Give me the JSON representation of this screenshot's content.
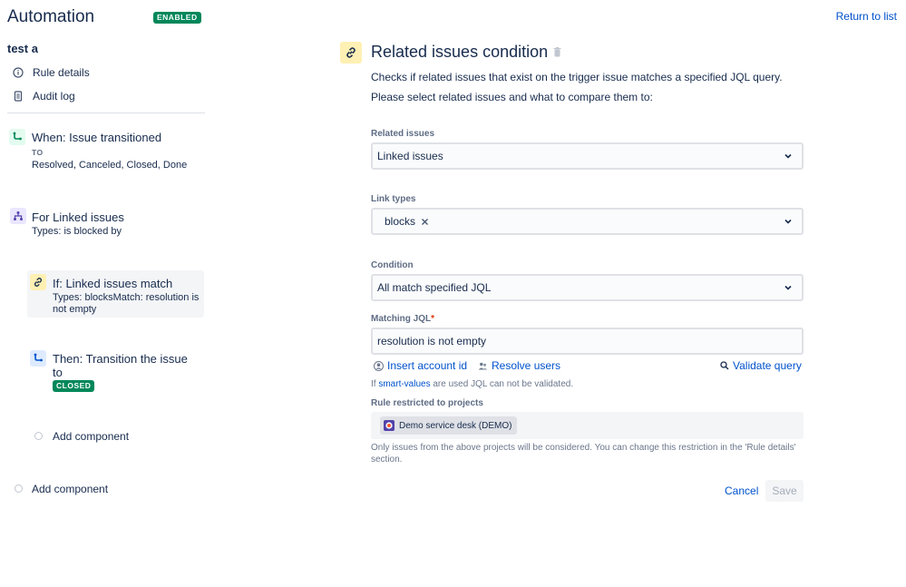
{
  "header": {
    "app_title": "Automation",
    "status_badge": "ENABLED",
    "return_link": "Return to list"
  },
  "sidebar": {
    "rule_name": "test a",
    "nav": [
      {
        "label": "Rule details",
        "icon": "info-icon"
      },
      {
        "label": "Audit log",
        "icon": "document-icon"
      }
    ],
    "trigger": {
      "title": "When: Issue transitioned",
      "to_label": "TO",
      "statuses": "Resolved, Canceled, Closed, Done"
    },
    "branch": {
      "title": "For Linked issues",
      "subtitle": "Types: is blocked by"
    },
    "condition": {
      "title": "If: Linked issues match",
      "subtitle": "Types: blocksMatch: resolution is not empty"
    },
    "action": {
      "title": "Then: Transition the issue to",
      "badge": "CLOSED"
    },
    "add_component_inner": "Add component",
    "add_component_outer": "Add component"
  },
  "panel": {
    "title": "Related issues condition",
    "description_1": "Checks if related issues that exist on the trigger issue matches a specified JQL query.",
    "description_2": "Please select related issues and what to compare them to:",
    "related_issues": {
      "label": "Related issues",
      "value": "Linked issues"
    },
    "link_types": {
      "label": "Link types",
      "tags": [
        "blocks"
      ]
    },
    "condition": {
      "label": "Condition",
      "value": "All match specified JQL"
    },
    "matching_jql": {
      "label": "Matching JQL",
      "required_mark": "*",
      "value": "resolution is not empty"
    },
    "insert_account_id": "Insert account id",
    "resolve_users": "Resolve users",
    "validate_query": "Validate query",
    "smart_hint_prefix": "If",
    "smart_hint_link": "smart-values",
    "smart_hint_suffix": "are used JQL can not be validated.",
    "projects_label": "Rule restricted to projects",
    "project_chip": "Demo service desk (DEMO)",
    "projects_hint": "Only issues from the above projects will be considered. You can change this restriction in the 'Rule details' section.",
    "cancel": "Cancel",
    "save": "Save"
  },
  "colors": {
    "accent": "#0052cc",
    "success": "#00875a",
    "condition_icon_bg": "#fff0b3",
    "selected_bg": "#f4f5f7"
  }
}
